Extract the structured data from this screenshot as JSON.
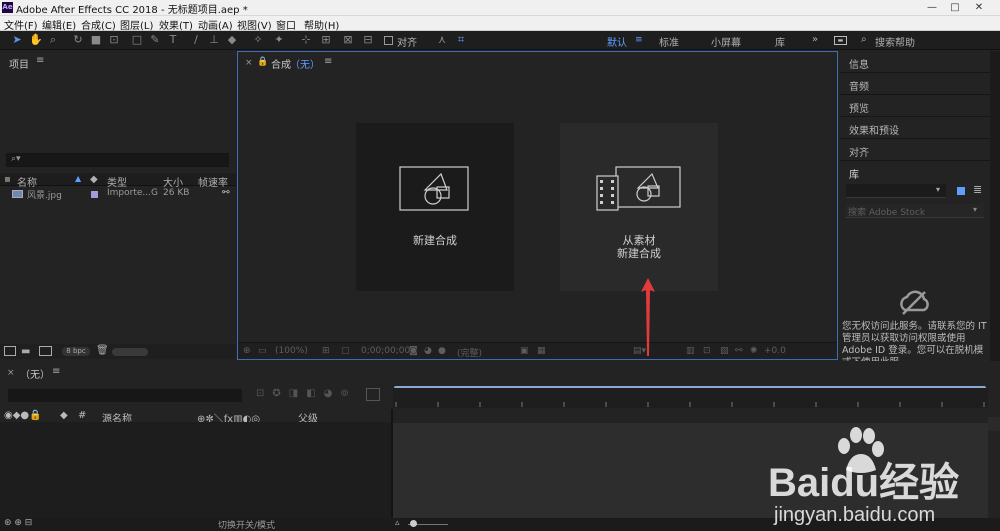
{
  "titlebar": {
    "app_icon": "Ae",
    "title": "Adobe After Effects CC 2018 - 无标题项目.aep *",
    "minimize": "—",
    "maximize": "□",
    "close": "✕"
  },
  "menu": [
    "文件(F)",
    "编辑(E)",
    "合成(C)",
    "图层(L)",
    "效果(T)",
    "动画(A)",
    "视图(V)",
    "窗口",
    "帮助(H)"
  ],
  "toolbar": {
    "snap_label": "对齐",
    "workspaces": [
      "默认",
      "标准",
      "小屏幕",
      "库"
    ],
    "more": "»",
    "search_label": "搜索帮助"
  },
  "project": {
    "header": "项目",
    "columns": [
      "名称",
      "类型",
      "大小",
      "帧速率"
    ],
    "items": [
      {
        "name": "风景.jpg",
        "type": "Importe...G",
        "size": "26 KB"
      }
    ],
    "bpc": "8 bpc"
  },
  "composition": {
    "header_label": "合成",
    "header_value": "（无）",
    "new_comp_label": "新建合成",
    "from_footage_label": "从素材",
    "from_footage_label2": "新建合成",
    "zoom": "(100%)",
    "timecode": "0;00;00;00",
    "resolution": "(完整)",
    "exposure": "+0.0"
  },
  "right_panels": [
    "信息",
    "音频",
    "预览",
    "效果和预设",
    "对齐",
    "库"
  ],
  "library": {
    "search_placeholder": "搜索 Adobe Stock",
    "message": "您无权访问此服务。请联系您的 IT 管理员以获取访问权限或使用 Adobe ID 登录。您可以在脱机模式下使用此服"
  },
  "timeline": {
    "tab_label": "（无）",
    "col_source": "源名称",
    "col_parent": "父级",
    "footer_label": "切换开关/模式"
  },
  "watermark": {
    "brand": "Baidu经验",
    "url": "jingyan.baidu.com"
  },
  "colors": {
    "accent": "#5f9dff",
    "panel_bg": "#232323",
    "arrow": "#e23b3b"
  }
}
